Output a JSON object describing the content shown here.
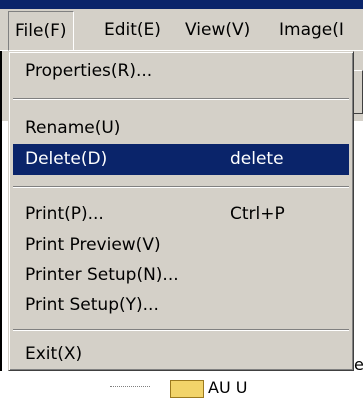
{
  "menubar": {
    "items": [
      "File(F)",
      "Edit(E)",
      "View(V)",
      "Image(I"
    ]
  },
  "file_menu": {
    "items": [
      {
        "label": "Properties(R)...",
        "shortcut": ""
      },
      {
        "label": "Rename(U)",
        "shortcut": ""
      },
      {
        "label": "Delete(D)",
        "shortcut": "delete",
        "selected": true
      },
      {
        "label": "Print(P)...",
        "shortcut": "Ctrl+P"
      },
      {
        "label": "Print Preview(V)",
        "shortcut": ""
      },
      {
        "label": "Printer Setup(N)...",
        "shortcut": ""
      },
      {
        "label": "Print Setup(Y)...",
        "shortcut": ""
      },
      {
        "label": "Exit(X)",
        "shortcut": ""
      }
    ]
  },
  "background": {
    "partial_text": "et",
    "tree_item_text": "AU U"
  },
  "colors": {
    "face": "#d4d0c8",
    "highlight": "#0a246a",
    "highlight_text": "#ffffff"
  }
}
